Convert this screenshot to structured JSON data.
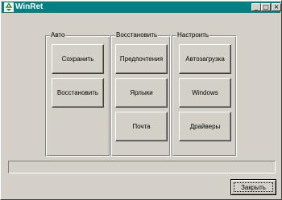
{
  "window": {
    "title": "WinRet",
    "icon": "recycle-icon",
    "controls": {
      "minimize": "_",
      "maximize": "□",
      "close": "×"
    }
  },
  "groups": {
    "auto": {
      "label": "Авто",
      "buttons": {
        "save": "Сохранить",
        "restore": "Восстановить"
      }
    },
    "restore": {
      "label": "Восстановить",
      "buttons": {
        "prefs": "Предпочтения",
        "links": "Ярлыки",
        "mail": "Почта"
      }
    },
    "configure": {
      "label": "Настроить",
      "buttons": {
        "autorun": "Автозагрузка",
        "windows": "Windows",
        "drivers": "Драйверы"
      }
    }
  },
  "progress": {
    "value": 0
  },
  "footer": {
    "close_label": "Закрыть"
  },
  "colors": {
    "titlebar": "#008080",
    "face": "#d4d0c8",
    "icon": "#2e8b2e"
  }
}
